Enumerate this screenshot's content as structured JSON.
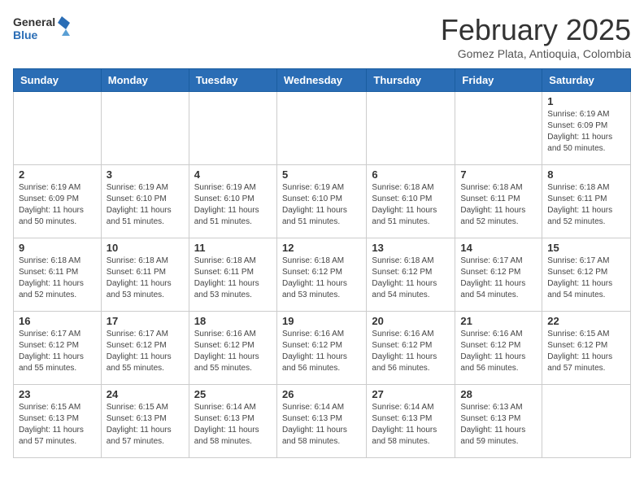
{
  "header": {
    "logo_line1": "General",
    "logo_line2": "Blue",
    "title": "February 2025",
    "subtitle": "Gomez Plata, Antioquia, Colombia"
  },
  "days_of_week": [
    "Sunday",
    "Monday",
    "Tuesday",
    "Wednesday",
    "Thursday",
    "Friday",
    "Saturday"
  ],
  "weeks": [
    [
      {
        "day": "",
        "info": ""
      },
      {
        "day": "",
        "info": ""
      },
      {
        "day": "",
        "info": ""
      },
      {
        "day": "",
        "info": ""
      },
      {
        "day": "",
        "info": ""
      },
      {
        "day": "",
        "info": ""
      },
      {
        "day": "1",
        "info": "Sunrise: 6:19 AM\nSunset: 6:09 PM\nDaylight: 11 hours and 50 minutes."
      }
    ],
    [
      {
        "day": "2",
        "info": "Sunrise: 6:19 AM\nSunset: 6:09 PM\nDaylight: 11 hours and 50 minutes."
      },
      {
        "day": "3",
        "info": "Sunrise: 6:19 AM\nSunset: 6:10 PM\nDaylight: 11 hours and 51 minutes."
      },
      {
        "day": "4",
        "info": "Sunrise: 6:19 AM\nSunset: 6:10 PM\nDaylight: 11 hours and 51 minutes."
      },
      {
        "day": "5",
        "info": "Sunrise: 6:19 AM\nSunset: 6:10 PM\nDaylight: 11 hours and 51 minutes."
      },
      {
        "day": "6",
        "info": "Sunrise: 6:18 AM\nSunset: 6:10 PM\nDaylight: 11 hours and 51 minutes."
      },
      {
        "day": "7",
        "info": "Sunrise: 6:18 AM\nSunset: 6:11 PM\nDaylight: 11 hours and 52 minutes."
      },
      {
        "day": "8",
        "info": "Sunrise: 6:18 AM\nSunset: 6:11 PM\nDaylight: 11 hours and 52 minutes."
      }
    ],
    [
      {
        "day": "9",
        "info": "Sunrise: 6:18 AM\nSunset: 6:11 PM\nDaylight: 11 hours and 52 minutes."
      },
      {
        "day": "10",
        "info": "Sunrise: 6:18 AM\nSunset: 6:11 PM\nDaylight: 11 hours and 53 minutes."
      },
      {
        "day": "11",
        "info": "Sunrise: 6:18 AM\nSunset: 6:11 PM\nDaylight: 11 hours and 53 minutes."
      },
      {
        "day": "12",
        "info": "Sunrise: 6:18 AM\nSunset: 6:12 PM\nDaylight: 11 hours and 53 minutes."
      },
      {
        "day": "13",
        "info": "Sunrise: 6:18 AM\nSunset: 6:12 PM\nDaylight: 11 hours and 54 minutes."
      },
      {
        "day": "14",
        "info": "Sunrise: 6:17 AM\nSunset: 6:12 PM\nDaylight: 11 hours and 54 minutes."
      },
      {
        "day": "15",
        "info": "Sunrise: 6:17 AM\nSunset: 6:12 PM\nDaylight: 11 hours and 54 minutes."
      }
    ],
    [
      {
        "day": "16",
        "info": "Sunrise: 6:17 AM\nSunset: 6:12 PM\nDaylight: 11 hours and 55 minutes."
      },
      {
        "day": "17",
        "info": "Sunrise: 6:17 AM\nSunset: 6:12 PM\nDaylight: 11 hours and 55 minutes."
      },
      {
        "day": "18",
        "info": "Sunrise: 6:16 AM\nSunset: 6:12 PM\nDaylight: 11 hours and 55 minutes."
      },
      {
        "day": "19",
        "info": "Sunrise: 6:16 AM\nSunset: 6:12 PM\nDaylight: 11 hours and 56 minutes."
      },
      {
        "day": "20",
        "info": "Sunrise: 6:16 AM\nSunset: 6:12 PM\nDaylight: 11 hours and 56 minutes."
      },
      {
        "day": "21",
        "info": "Sunrise: 6:16 AM\nSunset: 6:12 PM\nDaylight: 11 hours and 56 minutes."
      },
      {
        "day": "22",
        "info": "Sunrise: 6:15 AM\nSunset: 6:12 PM\nDaylight: 11 hours and 57 minutes."
      }
    ],
    [
      {
        "day": "23",
        "info": "Sunrise: 6:15 AM\nSunset: 6:13 PM\nDaylight: 11 hours and 57 minutes."
      },
      {
        "day": "24",
        "info": "Sunrise: 6:15 AM\nSunset: 6:13 PM\nDaylight: 11 hours and 57 minutes."
      },
      {
        "day": "25",
        "info": "Sunrise: 6:14 AM\nSunset: 6:13 PM\nDaylight: 11 hours and 58 minutes."
      },
      {
        "day": "26",
        "info": "Sunrise: 6:14 AM\nSunset: 6:13 PM\nDaylight: 11 hours and 58 minutes."
      },
      {
        "day": "27",
        "info": "Sunrise: 6:14 AM\nSunset: 6:13 PM\nDaylight: 11 hours and 58 minutes."
      },
      {
        "day": "28",
        "info": "Sunrise: 6:13 AM\nSunset: 6:13 PM\nDaylight: 11 hours and 59 minutes."
      },
      {
        "day": "",
        "info": ""
      }
    ]
  ]
}
